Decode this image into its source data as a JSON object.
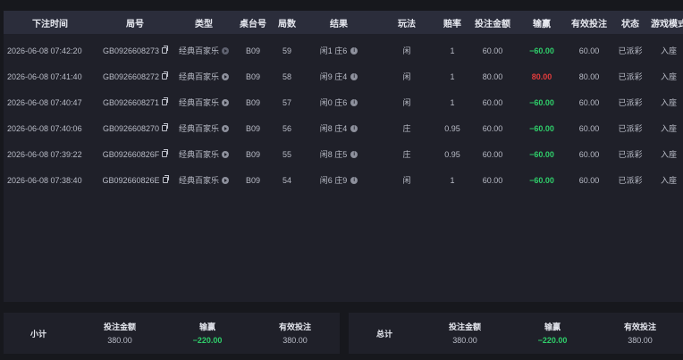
{
  "columns": [
    "下注时间",
    "局号",
    "类型",
    "桌台号",
    "局数",
    "结果",
    "玩法",
    "赔率",
    "投注金额",
    "输赢",
    "有效投注",
    "状态",
    "游戏模式"
  ],
  "rows": [
    {
      "time": "2026-06-08 07:42:20",
      "round_id": "GB0926608273",
      "type": "经典百家乐",
      "table": "B09",
      "round": "59",
      "result": "闲1 庄6",
      "play": "闲",
      "odds": "1",
      "bet": "60.00",
      "winloss": "−60.00",
      "winloss_sign": "pos",
      "valid": "60.00",
      "status": "已派彩",
      "mode": "入座",
      "type_icon": "dim"
    },
    {
      "time": "2026-06-08 07:41:40",
      "round_id": "GB0926608272",
      "type": "经典百家乐",
      "table": "B09",
      "round": "58",
      "result": "闲9 庄4",
      "play": "闲",
      "odds": "1",
      "bet": "80.00",
      "winloss": "80.00",
      "winloss_sign": "neg",
      "valid": "80.00",
      "status": "已派彩",
      "mode": "入座",
      "type_icon": "normal"
    },
    {
      "time": "2026-06-08 07:40:47",
      "round_id": "GB0926608271",
      "type": "经典百家乐",
      "table": "B09",
      "round": "57",
      "result": "闲0 庄6",
      "play": "闲",
      "odds": "1",
      "bet": "60.00",
      "winloss": "−60.00",
      "winloss_sign": "pos",
      "valid": "60.00",
      "status": "已派彩",
      "mode": "入座",
      "type_icon": "normal"
    },
    {
      "time": "2026-06-08 07:40:06",
      "round_id": "GB0926608270",
      "type": "经典百家乐",
      "table": "B09",
      "round": "56",
      "result": "闲8 庄4",
      "play": "庄",
      "odds": "0.95",
      "bet": "60.00",
      "winloss": "−60.00",
      "winloss_sign": "pos",
      "valid": "60.00",
      "status": "已派彩",
      "mode": "入座",
      "type_icon": "normal"
    },
    {
      "time": "2026-06-08 07:39:22",
      "round_id": "GB092660826F",
      "type": "经典百家乐",
      "table": "B09",
      "round": "55",
      "result": "闲8 庄5",
      "play": "庄",
      "odds": "0.95",
      "bet": "60.00",
      "winloss": "−60.00",
      "winloss_sign": "pos",
      "valid": "60.00",
      "status": "已派彩",
      "mode": "入座",
      "type_icon": "normal"
    },
    {
      "time": "2026-06-08 07:38:40",
      "round_id": "GB092660826E",
      "type": "经典百家乐",
      "table": "B09",
      "round": "54",
      "result": "闲6 庄9",
      "play": "闲",
      "odds": "1",
      "bet": "60.00",
      "winloss": "−60.00",
      "winloss_sign": "pos",
      "valid": "60.00",
      "status": "已派彩",
      "mode": "入座",
      "type_icon": "normal"
    }
  ],
  "subtotal": {
    "title": "小计",
    "bet_label": "投注金额",
    "bet": "380.00",
    "winloss_label": "输赢",
    "winloss": "−220.00",
    "valid_label": "有效投注",
    "valid": "380.00"
  },
  "total": {
    "title": "总计",
    "bet_label": "投注金额",
    "bet": "380.00",
    "winloss_label": "输赢",
    "winloss": "−220.00",
    "valid_label": "有效投注",
    "valid": "380.00"
  },
  "colors": {
    "positive": "#2fce6a",
    "negative": "#e23c3c",
    "header_bg": "#2b2d3b",
    "panel_bg": "#1f2029"
  }
}
